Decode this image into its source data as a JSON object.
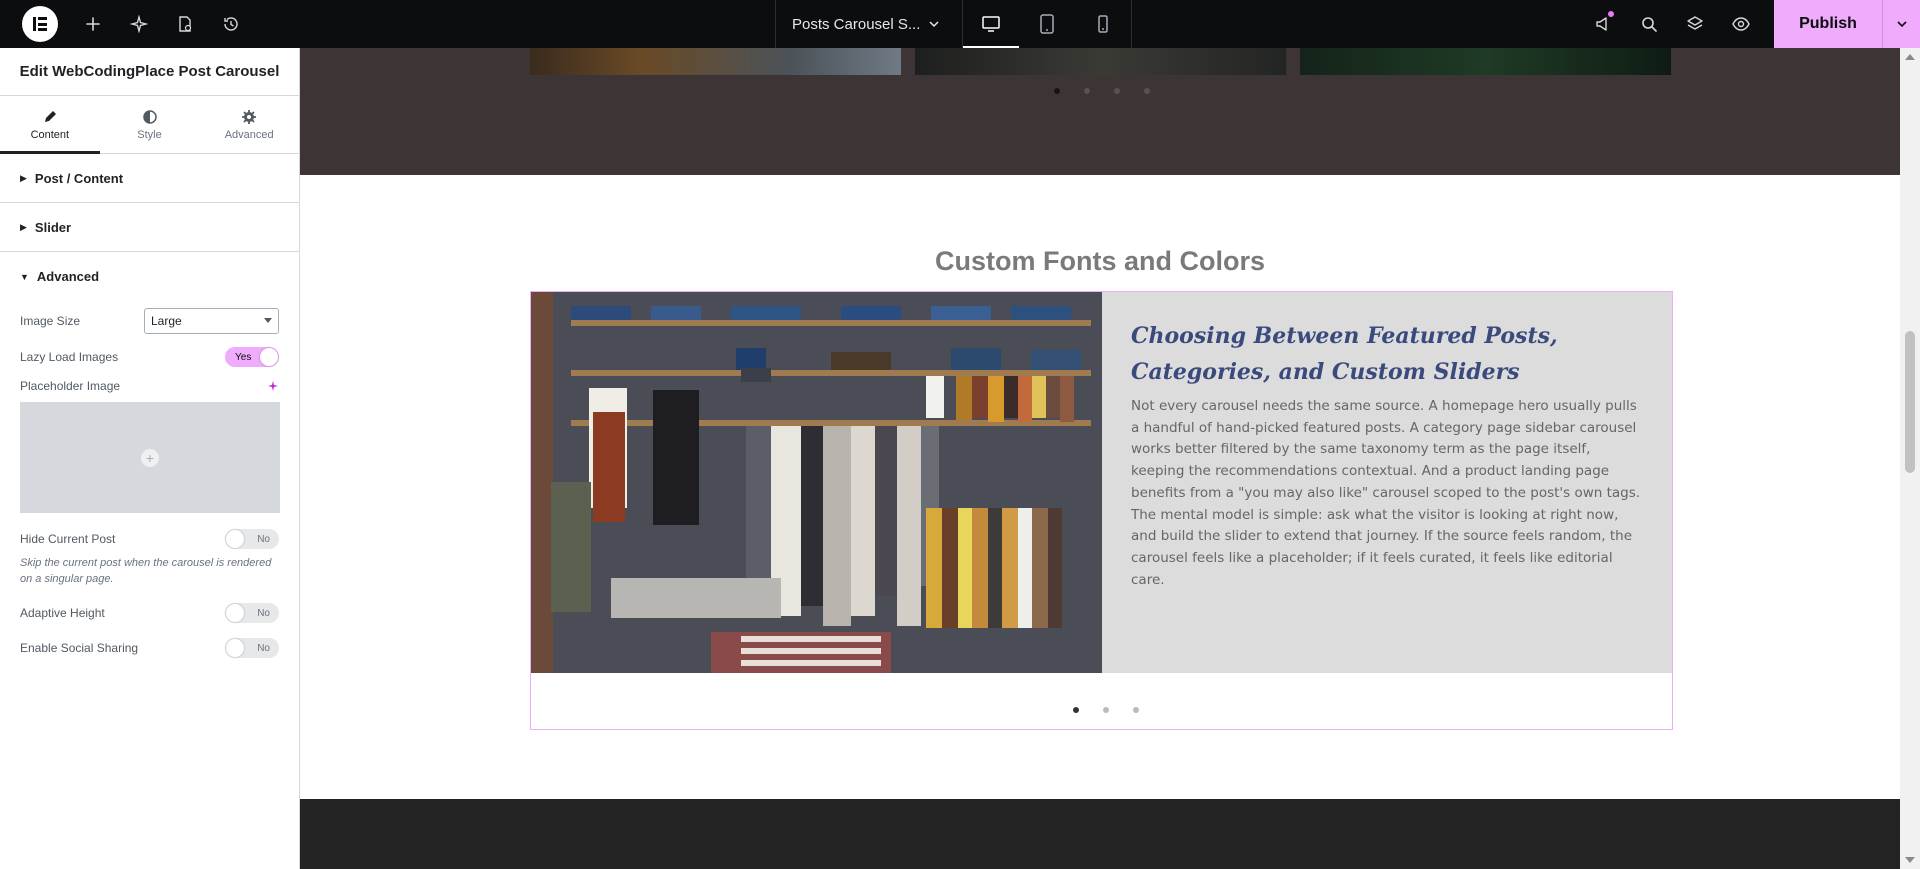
{
  "topbar": {
    "doc_title": "Posts Carousel S...",
    "publish_label": "Publish",
    "accent": "#f0abfc"
  },
  "panel": {
    "title": "Edit WebCodingPlace Post Carousel",
    "tabs": [
      {
        "label": "Content",
        "icon": "pencil-icon"
      },
      {
        "label": "Style",
        "icon": "half-circle-icon"
      },
      {
        "label": "Advanced",
        "icon": "gear-icon"
      }
    ],
    "sections": {
      "post_content": "Post / Content",
      "slider": "Slider",
      "advanced": "Advanced"
    },
    "controls": {
      "image_size_label": "Image Size",
      "image_size_value": "Large",
      "lazy_load_label": "Lazy Load Images",
      "lazy_load_value": "Yes",
      "placeholder_label": "Placeholder Image",
      "hide_current_label": "Hide Current Post",
      "hide_current_value": "No",
      "hide_current_desc": "Skip the current post when the carousel is rendered on a singular page.",
      "adaptive_height_label": "Adaptive Height",
      "adaptive_height_value": "No",
      "social_sharing_label": "Enable Social Sharing",
      "social_sharing_value": "No"
    }
  },
  "canvas": {
    "section_title": "Custom Fonts and Colors",
    "post_title": "Choosing Between Featured Posts, Categories, and Custom Sliders",
    "post_body": "Not every carousel needs the same source. A homepage hero usually pulls a handful of hand-picked featured posts. A category page sidebar carousel works better filtered by the same taxonomy term as the page itself, keeping the recommendations contextual. And a product landing page benefits from a \"you may also like\" carousel scoped to the post's own tags. The mental model is simple: ask what the visitor is looking at right now, and build the slider to extend that journey. If the source feels random, the carousel feels like a placeholder; if it feels curated, it feels like editorial care."
  }
}
